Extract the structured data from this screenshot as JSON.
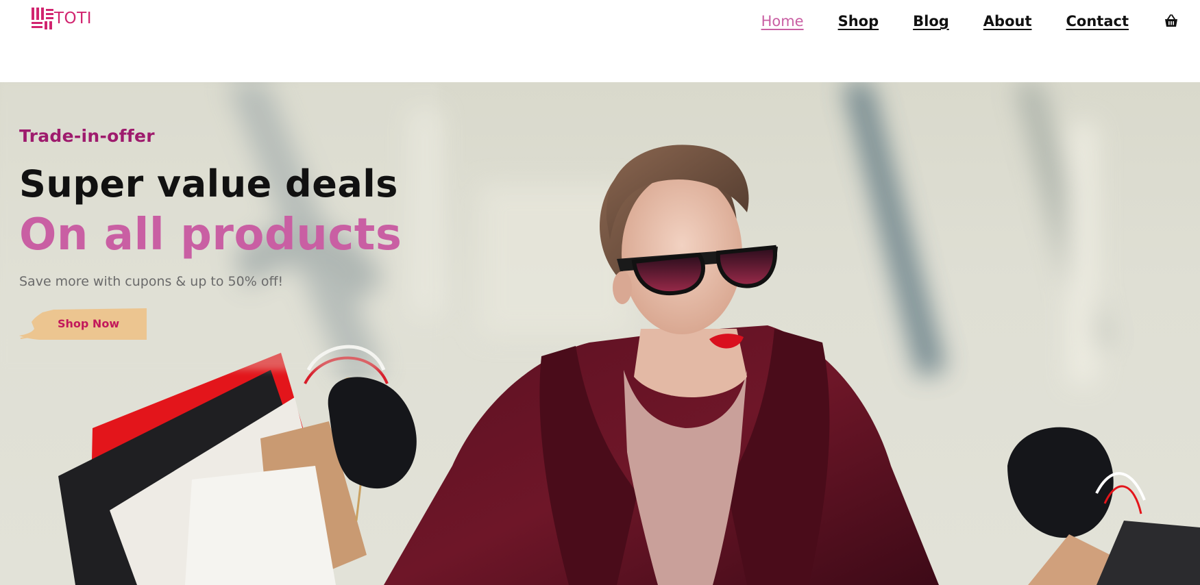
{
  "header": {
    "logo_text": "TOTI",
    "logo_icon": "tri-bar-logo-icon",
    "nav": [
      {
        "label": "Home",
        "active": true
      },
      {
        "label": "Shop",
        "active": false
      },
      {
        "label": "Blog",
        "active": false
      },
      {
        "label": "About",
        "active": false
      },
      {
        "label": "Contact",
        "active": false
      }
    ],
    "cart_icon": "shopping-basket-icon"
  },
  "hero": {
    "eyebrow": "Trade-in-offer",
    "headline": "Super value deals",
    "subheadline": "On all products",
    "description": "Save more with cupons & up to 50% off!",
    "cta_label": "Shop Now",
    "background_image": "woman-with-sunglasses-and-shopping-bags"
  },
  "colors": {
    "brand_pink": "#d1246f",
    "accent_pink": "#c95fa3",
    "eyebrow_purple": "#9e1b6d",
    "cta_bg": "#ecc590",
    "cta_text": "#c2185b",
    "text_dark": "#111111",
    "text_muted": "#6a6a6a"
  }
}
